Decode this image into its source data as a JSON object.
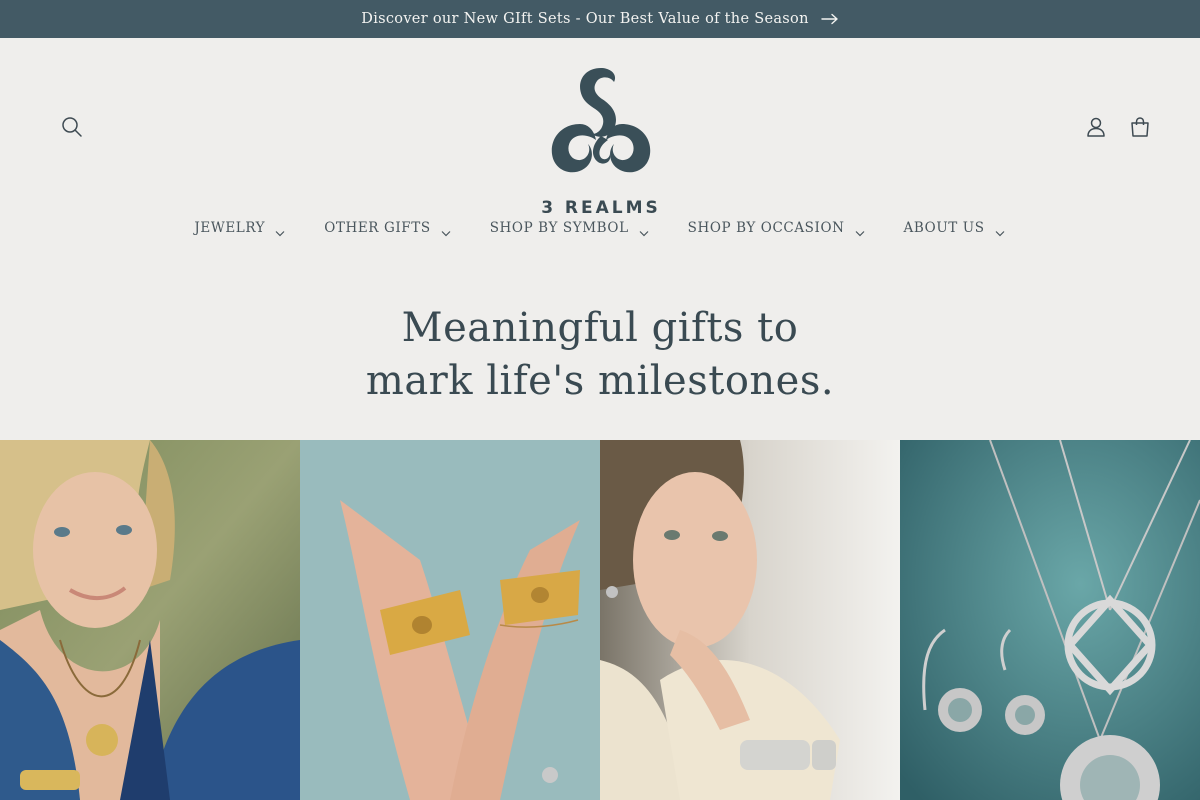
{
  "announcement": {
    "text": "Discover our New GIft Sets - Our Best Value of the Season",
    "icon": "arrow-right-icon"
  },
  "header": {
    "logo_text": "3 REALMS",
    "brand_color": "#3a4a52",
    "icons": [
      "search-icon",
      "account-icon",
      "cart-icon"
    ]
  },
  "nav": {
    "items": [
      {
        "label": "JEWELRY"
      },
      {
        "label": "OTHER GIFTS"
      },
      {
        "label": "SHOP BY SYMBOL"
      },
      {
        "label": "SHOP BY OCCASION"
      },
      {
        "label": "ABOUT US"
      }
    ]
  },
  "hero": {
    "line1": "Meaningful gifts to",
    "line2": "mark life's milestones."
  },
  "colors": {
    "announcement_bg": "#435a65",
    "page_bg": "#efeeec",
    "text": "#3a4a52"
  }
}
